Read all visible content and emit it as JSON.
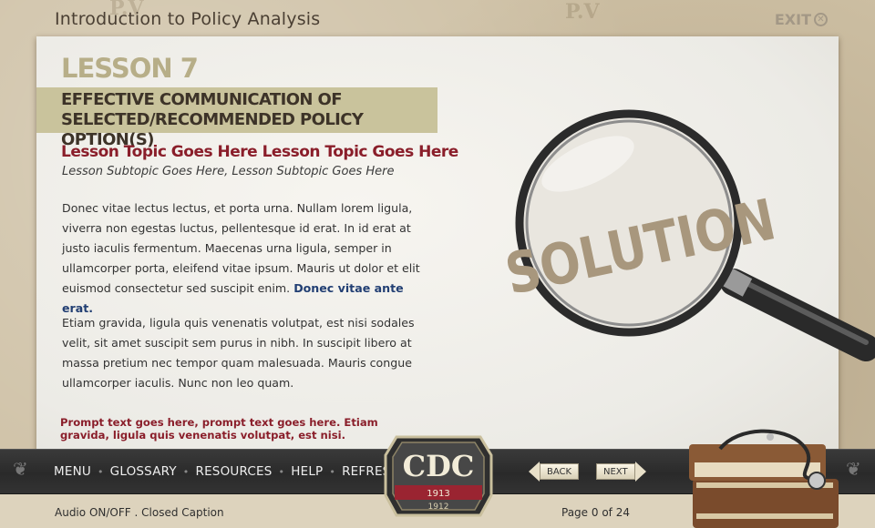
{
  "header": {
    "course_title": "Introduction to Policy Analysis",
    "exit_label": "EXIT",
    "background_watermark": "P.V"
  },
  "lesson": {
    "number_label": "LESSON 7",
    "title_line1": "EFFECTIVE COMMUNICATION OF",
    "title_line2": "SELECTED/RECOMMENDED POLICY OPTION(S)",
    "topic": "Lesson Topic Goes Here Lesson Topic Goes Here",
    "subtopic": "Lesson Subtopic Goes Here, Lesson Subtopic Goes Here"
  },
  "content": {
    "paragraph1_text": "Donec vitae lectus lectus, et porta urna. Nullam lorem ligula, viverra non egestas luctus, pellentesque id erat. In id erat at justo iaculis fermentum. Maecenas urna ligula, semper in ullamcorper porta, eleifend vitae ipsum. Mauris ut dolor et elit euismod consectetur sed suscipit enim.",
    "paragraph1_link": "Donec vitae ante erat.",
    "paragraph2_text": "Etiam gravida, ligula quis venenatis volutpat, est nisi sodales velit, sit amet suscipit sem purus in nibh. In suscipit libero at massa pretium nec tempor quam malesuada. Mauris congue ullamcorper iaculis. Nunc non leo quam.",
    "prompt": "Prompt text goes here, prompt text goes here.  Etiam gravida, ligula quis venenatis volutpat, est nisi."
  },
  "image": {
    "magnifier_word": "SOLUTION"
  },
  "nav": {
    "items": [
      "MENU",
      "GLOSSARY",
      "RESOURCES",
      "HELP",
      "REFRESH"
    ],
    "back_label": "BACK",
    "next_label": "NEXT"
  },
  "logo": {
    "text": "CDC",
    "year_top": "1913",
    "year_bottom": "1912"
  },
  "footer": {
    "audio_label": "Audio",
    "audio_toggle": "ON/OFF",
    "caption_label": "Closed Caption",
    "page_indicator": "Page 0 of 24"
  },
  "colors": {
    "accent_red": "#8a1e2a",
    "link_blue": "#223f73",
    "band_khaki": "#c9c39c",
    "nav_dark": "#2e2e2e"
  }
}
